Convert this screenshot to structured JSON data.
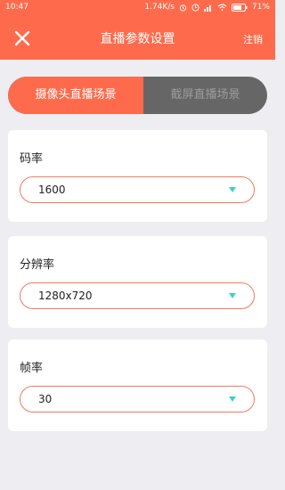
{
  "status": {
    "time": "10:47",
    "speed": "1.74K/s",
    "battery": "71%"
  },
  "appbar": {
    "title": "直播参数设置",
    "logout_label": "注销"
  },
  "toggle": {
    "camera_label": "摄像头直播场景",
    "screen_label": "截屏直播场景"
  },
  "bitrate": {
    "label": "码率",
    "value": "1600"
  },
  "resolution": {
    "label": "分辨率",
    "value": "1280x720"
  },
  "framerate": {
    "label": "帧率",
    "value": "30"
  },
  "colors": {
    "accent": "#fe6b4c",
    "dropdown_arrow": "#3ed1c0"
  }
}
